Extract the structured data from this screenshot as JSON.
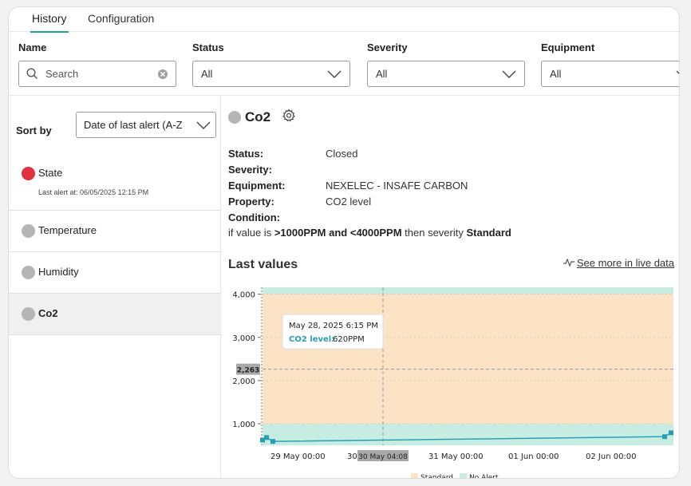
{
  "tabs": [
    {
      "label": "History"
    },
    {
      "label": "Configuration"
    }
  ],
  "filters": {
    "name": {
      "label": "Name",
      "placeholder": "Search"
    },
    "status": {
      "label": "Status",
      "value": "All"
    },
    "severity": {
      "label": "Severity",
      "value": "All"
    },
    "equipment": {
      "label": "Equipment",
      "value": "All"
    }
  },
  "sort": {
    "label": "Sort by",
    "value": "Date of last alert (A-Z"
  },
  "alerts": [
    {
      "name": "State",
      "subtitle": "Last alert at: 06/05/2025 12:15 PM",
      "color": "#e0323f"
    },
    {
      "name": "Temperature"
    },
    {
      "name": "Humidity"
    },
    {
      "name": "Co2"
    }
  ],
  "detail": {
    "title": "Co2",
    "status_label": "Status:",
    "status_value": "Closed",
    "severity_label": "Severity:",
    "equipment_label": "Equipment:",
    "equipment_value": "NEXELEC - INSAFE CARBON",
    "property_label": "Property:",
    "property_value": "CO2 level",
    "condition_label": "Condition:",
    "condition_prefix": "if value is",
    "condition_range": ">1000PPM and <4000PPM",
    "condition_mid": "then severity",
    "condition_severity": "Standard",
    "last_values": "Last values",
    "see_more": "See more in live data"
  },
  "chart_data": {
    "type": "line",
    "y_ticks": [
      "4,000",
      "3,000",
      "2,000",
      "1,000"
    ],
    "x_ticks": [
      "29 May 00:00",
      "30 M",
      "31 May 00:00",
      "01 Jun 00:00",
      "02 Jun 00:00"
    ],
    "crosshair_x_label": "30 May 04:08",
    "crosshair_y_label": "2,263",
    "tooltip": {
      "date": "May 28, 2025 6:15 PM",
      "series": "CO2 level",
      "value": "620PPM"
    },
    "bands": [
      {
        "name": "Standard",
        "from": 1000,
        "to": 4000,
        "color": "#fde3c6"
      },
      {
        "name": "No Alert",
        "color": "#c7ece1"
      }
    ],
    "legend": [
      "Standard",
      "No Alert"
    ],
    "series": [
      {
        "name": "CO2 level",
        "color": "#2a9fb3",
        "values": [
          620,
          680,
          590,
          700,
          790
        ]
      }
    ]
  }
}
